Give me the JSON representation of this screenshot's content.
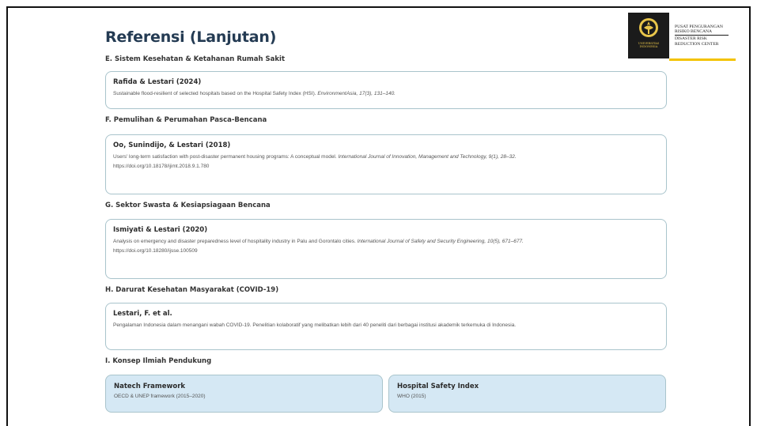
{
  "page": {
    "title": "Referensi (Lanjutan)"
  },
  "logo": {
    "university_text": [
      "UNIVERSITAS",
      "INDONESIA"
    ],
    "center_lines": [
      "PUSAT PENGURANGAN",
      "RISIKO BENCANA",
      "DISASTER RISK",
      "REDUCTION CENTER"
    ],
    "colors": {
      "box": "#1b1b1b",
      "gold": "#f3c300"
    }
  },
  "sections": [
    {
      "heading": "E. Sistem Kesehatan & Ketahanan Rumah Sakit",
      "card": {
        "title": "Rafida & Lestari (2024)",
        "text": "Sustainable flood-resilient of selected hospitals based on the Hospital Safety Index (HSI). ",
        "journal": "EnvironmentAsia, 17(3), 131–140.",
        "doi": ""
      }
    },
    {
      "heading": "F. Pemulihan & Perumahan Pasca-Bencana",
      "card": {
        "title": "Oo, Sunindijo, & Lestari (2018)",
        "text": "Users' long-term satisfaction with post-disaster permanent housing programs: A conceptual model. ",
        "journal": "International Journal of Innovation, Management and Technology, 9(1), 28–32.",
        "doi": "https://doi.org/10.18178/ijimt.2018.9.1.780"
      }
    },
    {
      "heading": "G. Sektor Swasta & Kesiapsiagaan Bencana",
      "card": {
        "title": "Ismiyati & Lestari (2020)",
        "text": "Analysis on emergency and disaster preparedness level of hospitality industry in Palu and Gorontalo cities. ",
        "journal": "International Journal of Safety and Security Engineering, 10(5), 671–677.",
        "doi": "https://doi.org/10.18280/ijsse.100509"
      }
    },
    {
      "heading": "H. Darurat Kesehatan Masyarakat (COVID-19)",
      "card": {
        "title": "Lestari, F. et al.",
        "text": "Pengalaman Indonesia dalam menangani wabah COVID-19. Penelitian kolaboratif yang melibatkan lebih dari 40 peneliti dari berbagai institusi akademik terkemuka di Indonesia.",
        "journal": "",
        "doi": ""
      }
    },
    {
      "heading": "I. Konsep Ilmiah Pendukung"
    }
  ],
  "concepts": [
    {
      "title": "Natech Framework",
      "subtitle": "OECD & UNEP framework (2015–2020)"
    },
    {
      "title": "Hospital Safety Index",
      "subtitle": "WHO (2015)"
    }
  ],
  "colors": {
    "title": "#243b53",
    "card_border": "#a9c4cc",
    "concept_bg": "#d5e8f4"
  }
}
